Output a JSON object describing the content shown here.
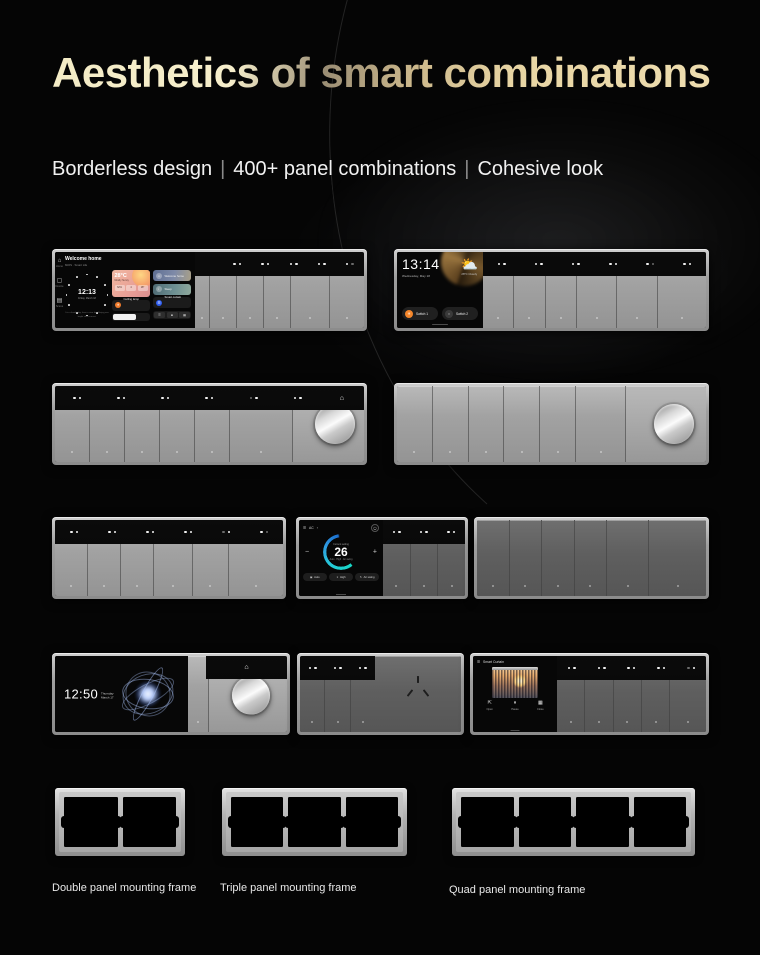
{
  "headline": {
    "lead": "Aesthetics of ",
    "accent": "smart combinations"
  },
  "subline": {
    "a": "Borderless design",
    "b": "400+ panel combinations",
    "c": "Cohesive look",
    "sep": "|"
  },
  "screens": {
    "dashboard": {
      "greeting": "Welcome home",
      "greeting_sub": "MiOS  ·  Smart Life",
      "rail": [
        {
          "icon": "home-icon",
          "glyph": "⌂",
          "label": "Home"
        },
        {
          "icon": "device-icon",
          "glyph": "▢",
          "label": "Device"
        },
        {
          "icon": "scene-icon",
          "glyph": "▤",
          "label": "Scene"
        }
      ],
      "clock": {
        "time": "12:13",
        "date": "Friday, March 18",
        "note": "It is a lovely day, have a nice day. Enjoy your bright clear sunset."
      },
      "weather": {
        "temp": "28°C",
        "condition": "Mostly Sunny",
        "stats": [
          "62%",
          "4",
          "18°"
        ]
      },
      "scenes": [
        {
          "name": "Welcome home",
          "icon": "home-scene-icon",
          "glyph": "⌂"
        },
        {
          "name": "Sleep",
          "icon": "moon-icon",
          "glyph": "☾"
        }
      ],
      "devices": [
        {
          "name": "Ceiling lamp",
          "status": "98%  ·  Living room",
          "icon": "bulb-icon",
          "glyph": "☀",
          "accent": "#f07c2c"
        },
        {
          "name": "Smart curtain",
          "status": "Opened 60%  ·  Hall",
          "icon": "curtain-icon",
          "glyph": "☰",
          "accent": "#2f5df0"
        }
      ],
      "curtain_actions": [
        "☰",
        "■",
        "▦"
      ]
    },
    "clockswitch": {
      "time": "13:14",
      "date": "Wednesday, May 18",
      "weather": {
        "glyph": "⛅",
        "label": "28°C  Cloudy"
      },
      "switches": [
        {
          "name": "Switch 1",
          "state": "on",
          "glyph": "☀"
        },
        {
          "name": "Switch 2",
          "state": "off",
          "glyph": "○"
        }
      ]
    },
    "ac": {
      "menu_icon": "menu-icon",
      "title": "AC",
      "chevron": "›",
      "power_icon": "power-icon",
      "caption": "Current setting",
      "temperature": "26",
      "sub": "Auto  ·  High  ·  Air swing",
      "minus": "−",
      "plus": "+",
      "modes": [
        {
          "label": "Auto",
          "glyph": "▣"
        },
        {
          "label": "High",
          "glyph": "✶"
        },
        {
          "label": "Air swing",
          "glyph": "↻"
        }
      ]
    },
    "ambient": {
      "time": "12:50",
      "day": "Thursday",
      "date": "March 17"
    },
    "curtain": {
      "menu_icon": "menu-icon",
      "title": "Smart Curtain",
      "controls": [
        {
          "label": "Open",
          "glyph": "⇱",
          "icon": "open-icon"
        },
        {
          "label": "Pause",
          "glyph": "⏸",
          "icon": "pause-icon"
        },
        {
          "label": "Close",
          "glyph": "▦",
          "icon": "close-icon"
        }
      ]
    }
  },
  "frames": [
    {
      "caption": "Double panel mounting frame",
      "slots": 2
    },
    {
      "caption": "Triple panel mounting frame",
      "slots": 3
    },
    {
      "caption": "Quad panel mounting frame",
      "slots": 4
    }
  ],
  "colors": {
    "background": "#050505",
    "headline_gold": "#e8d5a4",
    "panel_silver": "#b9b9b9",
    "accent_orange": "#f5862a",
    "accent_blue": "#2f5df0",
    "ac_arc_teal": "#17d6c4"
  }
}
